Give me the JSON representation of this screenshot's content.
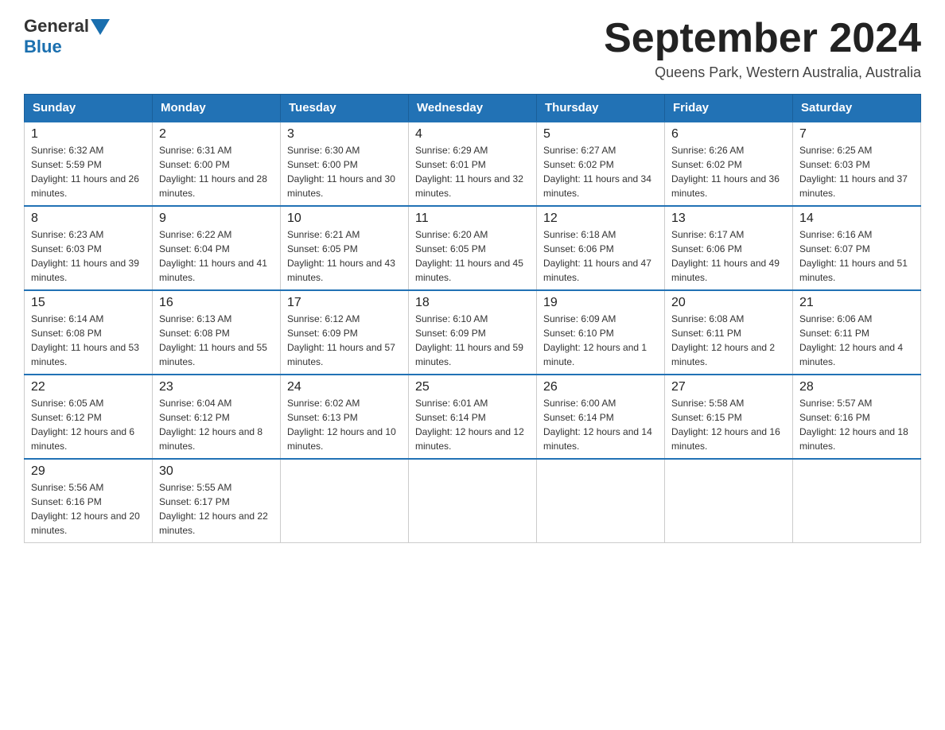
{
  "header": {
    "logo_general": "General",
    "logo_blue": "Blue",
    "month_title": "September 2024",
    "location": "Queens Park, Western Australia, Australia"
  },
  "weekdays": [
    "Sunday",
    "Monday",
    "Tuesday",
    "Wednesday",
    "Thursday",
    "Friday",
    "Saturday"
  ],
  "weeks": [
    [
      {
        "day": "1",
        "sunrise": "6:32 AM",
        "sunset": "5:59 PM",
        "daylight": "11 hours and 26 minutes."
      },
      {
        "day": "2",
        "sunrise": "6:31 AM",
        "sunset": "6:00 PM",
        "daylight": "11 hours and 28 minutes."
      },
      {
        "day": "3",
        "sunrise": "6:30 AM",
        "sunset": "6:00 PM",
        "daylight": "11 hours and 30 minutes."
      },
      {
        "day": "4",
        "sunrise": "6:29 AM",
        "sunset": "6:01 PM",
        "daylight": "11 hours and 32 minutes."
      },
      {
        "day": "5",
        "sunrise": "6:27 AM",
        "sunset": "6:02 PM",
        "daylight": "11 hours and 34 minutes."
      },
      {
        "day": "6",
        "sunrise": "6:26 AM",
        "sunset": "6:02 PM",
        "daylight": "11 hours and 36 minutes."
      },
      {
        "day": "7",
        "sunrise": "6:25 AM",
        "sunset": "6:03 PM",
        "daylight": "11 hours and 37 minutes."
      }
    ],
    [
      {
        "day": "8",
        "sunrise": "6:23 AM",
        "sunset": "6:03 PM",
        "daylight": "11 hours and 39 minutes."
      },
      {
        "day": "9",
        "sunrise": "6:22 AM",
        "sunset": "6:04 PM",
        "daylight": "11 hours and 41 minutes."
      },
      {
        "day": "10",
        "sunrise": "6:21 AM",
        "sunset": "6:05 PM",
        "daylight": "11 hours and 43 minutes."
      },
      {
        "day": "11",
        "sunrise": "6:20 AM",
        "sunset": "6:05 PM",
        "daylight": "11 hours and 45 minutes."
      },
      {
        "day": "12",
        "sunrise": "6:18 AM",
        "sunset": "6:06 PM",
        "daylight": "11 hours and 47 minutes."
      },
      {
        "day": "13",
        "sunrise": "6:17 AM",
        "sunset": "6:06 PM",
        "daylight": "11 hours and 49 minutes."
      },
      {
        "day": "14",
        "sunrise": "6:16 AM",
        "sunset": "6:07 PM",
        "daylight": "11 hours and 51 minutes."
      }
    ],
    [
      {
        "day": "15",
        "sunrise": "6:14 AM",
        "sunset": "6:08 PM",
        "daylight": "11 hours and 53 minutes."
      },
      {
        "day": "16",
        "sunrise": "6:13 AM",
        "sunset": "6:08 PM",
        "daylight": "11 hours and 55 minutes."
      },
      {
        "day": "17",
        "sunrise": "6:12 AM",
        "sunset": "6:09 PM",
        "daylight": "11 hours and 57 minutes."
      },
      {
        "day": "18",
        "sunrise": "6:10 AM",
        "sunset": "6:09 PM",
        "daylight": "11 hours and 59 minutes."
      },
      {
        "day": "19",
        "sunrise": "6:09 AM",
        "sunset": "6:10 PM",
        "daylight": "12 hours and 1 minute."
      },
      {
        "day": "20",
        "sunrise": "6:08 AM",
        "sunset": "6:11 PM",
        "daylight": "12 hours and 2 minutes."
      },
      {
        "day": "21",
        "sunrise": "6:06 AM",
        "sunset": "6:11 PM",
        "daylight": "12 hours and 4 minutes."
      }
    ],
    [
      {
        "day": "22",
        "sunrise": "6:05 AM",
        "sunset": "6:12 PM",
        "daylight": "12 hours and 6 minutes."
      },
      {
        "day": "23",
        "sunrise": "6:04 AM",
        "sunset": "6:12 PM",
        "daylight": "12 hours and 8 minutes."
      },
      {
        "day": "24",
        "sunrise": "6:02 AM",
        "sunset": "6:13 PM",
        "daylight": "12 hours and 10 minutes."
      },
      {
        "day": "25",
        "sunrise": "6:01 AM",
        "sunset": "6:14 PM",
        "daylight": "12 hours and 12 minutes."
      },
      {
        "day": "26",
        "sunrise": "6:00 AM",
        "sunset": "6:14 PM",
        "daylight": "12 hours and 14 minutes."
      },
      {
        "day": "27",
        "sunrise": "5:58 AM",
        "sunset": "6:15 PM",
        "daylight": "12 hours and 16 minutes."
      },
      {
        "day": "28",
        "sunrise": "5:57 AM",
        "sunset": "6:16 PM",
        "daylight": "12 hours and 18 minutes."
      }
    ],
    [
      {
        "day": "29",
        "sunrise": "5:56 AM",
        "sunset": "6:16 PM",
        "daylight": "12 hours and 20 minutes."
      },
      {
        "day": "30",
        "sunrise": "5:55 AM",
        "sunset": "6:17 PM",
        "daylight": "12 hours and 22 minutes."
      },
      null,
      null,
      null,
      null,
      null
    ]
  ]
}
